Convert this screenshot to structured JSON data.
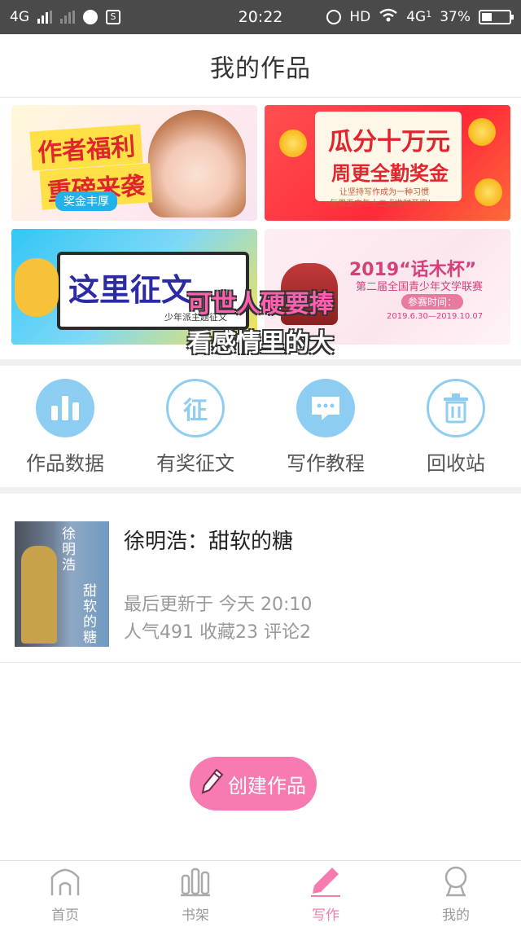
{
  "status_bar": {
    "network_left": "4G",
    "time": "20:22",
    "hd": "HD",
    "network_right": "4G",
    "network_right_sub": "1",
    "battery": "37%",
    "battery_level": 0.37
  },
  "header": {
    "title": "我的作品"
  },
  "banners": [
    {
      "name": "author-welfare",
      "lines": [
        "作者福利",
        "重磅来袭",
        "奖金丰厚"
      ]
    },
    {
      "name": "bonus-pool",
      "lines": [
        "瓜分十万元",
        "周更全勤奖金",
        "让坚持写作成为一种习惯",
        "每周五中午十二点准时开奖！"
      ]
    },
    {
      "name": "writing-contest",
      "lines": [
        "这里征文",
        "少年派主题征文"
      ]
    },
    {
      "name": "huamu-cup",
      "lines": [
        "2019“话木杯”",
        "第二届全国青少年文学联赛",
        "参赛时间：",
        "2019.6.30—2019.10.07"
      ]
    }
  ],
  "overlay_subtitle": {
    "line1": "可世人硬要捧",
    "line2": "看感情里的大"
  },
  "features": [
    {
      "label": "作品数据",
      "icon": "bar-chart-icon"
    },
    {
      "label": "有奖征文",
      "icon": "contest-icon",
      "glyph": "征"
    },
    {
      "label": "写作教程",
      "icon": "chat-bubble-icon"
    },
    {
      "label": "回收站",
      "icon": "trash-icon"
    }
  ],
  "work": {
    "title": "徐明浩：甜软的糖",
    "updated": "最后更新于 今天 20:10",
    "stats": "人气491 收藏23 评论2",
    "cover_text1": "徐明浩",
    "cover_text2": "甜软的糖"
  },
  "create_button": {
    "label": "创建作品",
    "icon": "pencil-icon"
  },
  "bottom_nav": [
    {
      "label": "首页",
      "icon": "home-icon"
    },
    {
      "label": "书架",
      "icon": "bookshelf-icon"
    },
    {
      "label": "写作",
      "icon": "pencil-icon"
    },
    {
      "label": "我的",
      "icon": "profile-icon"
    }
  ],
  "colors": {
    "accent": "#f77bb0",
    "icon_blue": "#8ecdf2",
    "status_bar": "#4a4a4a"
  }
}
